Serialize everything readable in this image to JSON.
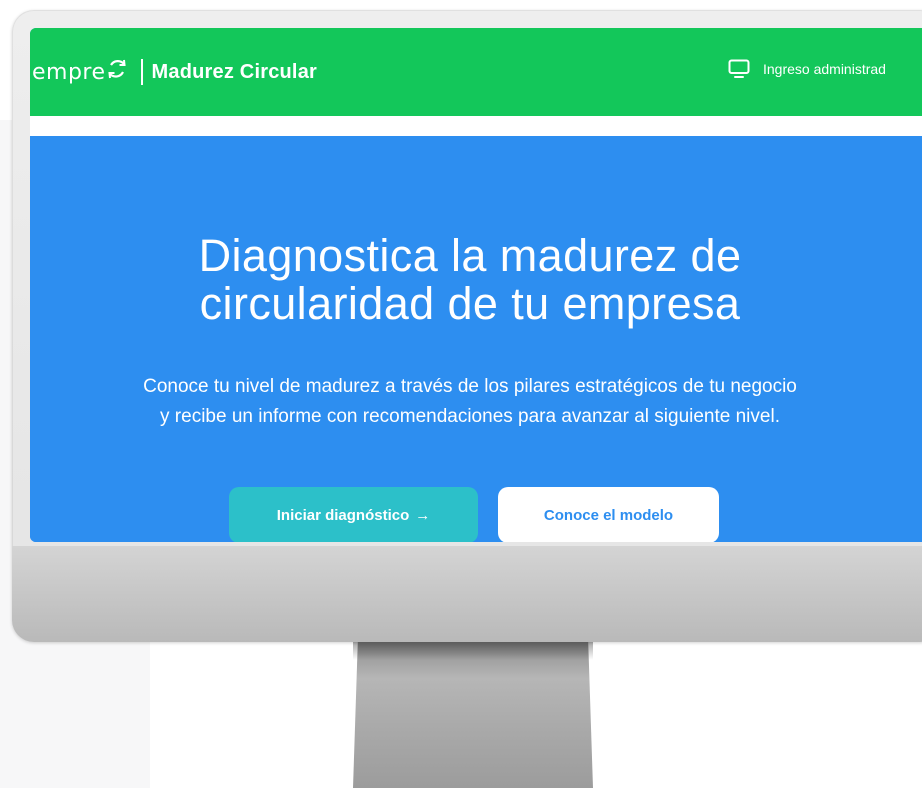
{
  "brand": {
    "logo_text": "empre",
    "title": "Madurez Circular"
  },
  "nav": {
    "admin_label": "Ingreso administrad"
  },
  "hero": {
    "title_line1": "Diagnostica la madurez de",
    "title_line2": "circularidad de tu empresa",
    "subtitle_line1": "Conoce tu nivel de madurez a través de los pilares estratégicos de tu negocio",
    "subtitle_line2": "y recibe un informe con recomendaciones para avanzar al siguiente nivel.",
    "primary_button": "Iniciar diagnóstico",
    "primary_button_arrow": "→",
    "secondary_button": "Conoce el modelo"
  },
  "icons": {
    "logo": "circular-arrows-icon",
    "admin": "monitor-icon"
  },
  "colors": {
    "navbar": "#13c75a",
    "hero": "#2d8ef0",
    "primary_button": "#2cc0c9",
    "secondary_button_text": "#2d8ef0"
  }
}
